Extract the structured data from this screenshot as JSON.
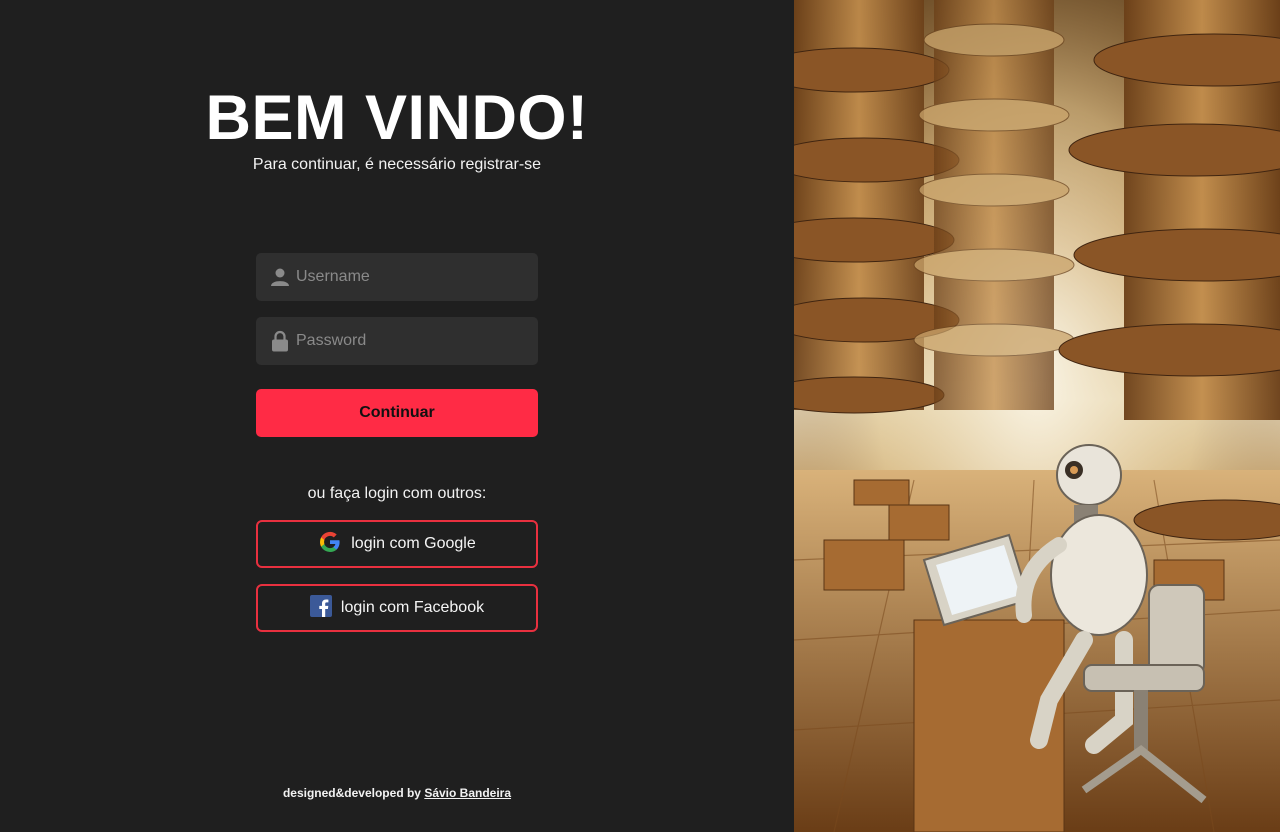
{
  "login": {
    "title": "BEM VINDO!",
    "subtitle": "Para continuar, é necessário registrar-se",
    "username_placeholder": "Username",
    "password_placeholder": "Password",
    "continue_label": "Continuar",
    "alt_login_text": "ou faça login com outros:",
    "google_label": "login com Google",
    "facebook_label": "login com Facebook"
  },
  "footer": {
    "credit_text": "designed&developed by",
    "author_link": "Sávio Bandeira"
  },
  "colors": {
    "background": "#1f1f1f",
    "input_bg": "#2f2f2f",
    "accent": "#ff2b45",
    "social_border": "#e8303f"
  },
  "icons": {
    "username": "user-icon",
    "password": "lock-icon",
    "google": "google-icon",
    "facebook": "facebook-icon"
  }
}
